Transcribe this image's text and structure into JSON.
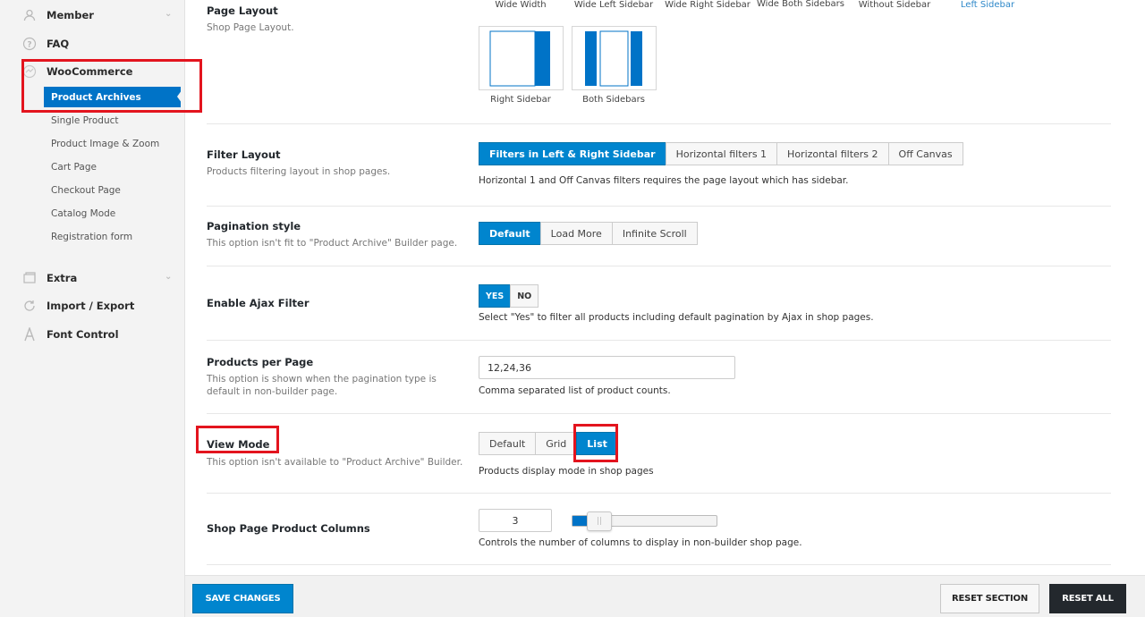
{
  "sidebar": {
    "member": "Member",
    "faq": "FAQ",
    "woocommerce": "WooCommerce",
    "active_item": "Product Archives",
    "sub_items": [
      "Single Product",
      "Product Image & Zoom",
      "Cart Page",
      "Checkout Page",
      "Catalog Mode",
      "Registration form"
    ],
    "extra": "Extra",
    "import_export": "Import / Export",
    "font_control": "Font Control"
  },
  "page_layout": {
    "title": "Page Layout",
    "desc": "Shop Page Layout.",
    "options_top": [
      "Wide Width",
      "Wide Left Sidebar",
      "Wide Right Sidebar",
      "Wide Both Sidebars",
      "Without Sidebar",
      "Left Sidebar"
    ],
    "options_bottom": [
      "Right Sidebar",
      "Both Sidebars"
    ]
  },
  "filter_layout": {
    "title": "Filter Layout",
    "desc": "Products filtering layout in shop pages.",
    "options": [
      "Filters in Left & Right Sidebar",
      "Horizontal filters 1",
      "Horizontal filters 2",
      "Off Canvas"
    ],
    "note": "Horizontal 1 and Off Canvas filters requires the page layout which has sidebar."
  },
  "pagination": {
    "title": "Pagination style",
    "desc": "This option isn't fit to \"Product Archive\" Builder page.",
    "options": [
      "Default",
      "Load More",
      "Infinite Scroll"
    ]
  },
  "ajax_filter": {
    "title": "Enable Ajax Filter",
    "yes": "YES",
    "no": "NO",
    "note": "Select \"Yes\" to filter all products including default pagination by Ajax in shop pages."
  },
  "products_per_page": {
    "title": "Products per Page",
    "desc_line1": "This option is shown when the pagination type is",
    "desc_line2": "default in non-builder page.",
    "value": "12,24,36",
    "note": "Comma separated list of product counts."
  },
  "view_mode": {
    "title": "View Mode",
    "desc": "This option isn't available to \"Product Archive\" Builder.",
    "options": [
      "Default",
      "Grid",
      "List"
    ],
    "note": "Products display mode in shop pages"
  },
  "columns": {
    "title": "Shop Page Product Columns",
    "value": "3",
    "slider_fraction": 0.1,
    "note": "Controls the number of columns to display in non-builder shop page."
  },
  "footer": {
    "save": "SAVE CHANGES",
    "reset_section": "RESET SECTION",
    "reset_all": "RESET ALL"
  },
  "colors": {
    "accent": "#0085ce",
    "highlight": "#e3141e"
  }
}
